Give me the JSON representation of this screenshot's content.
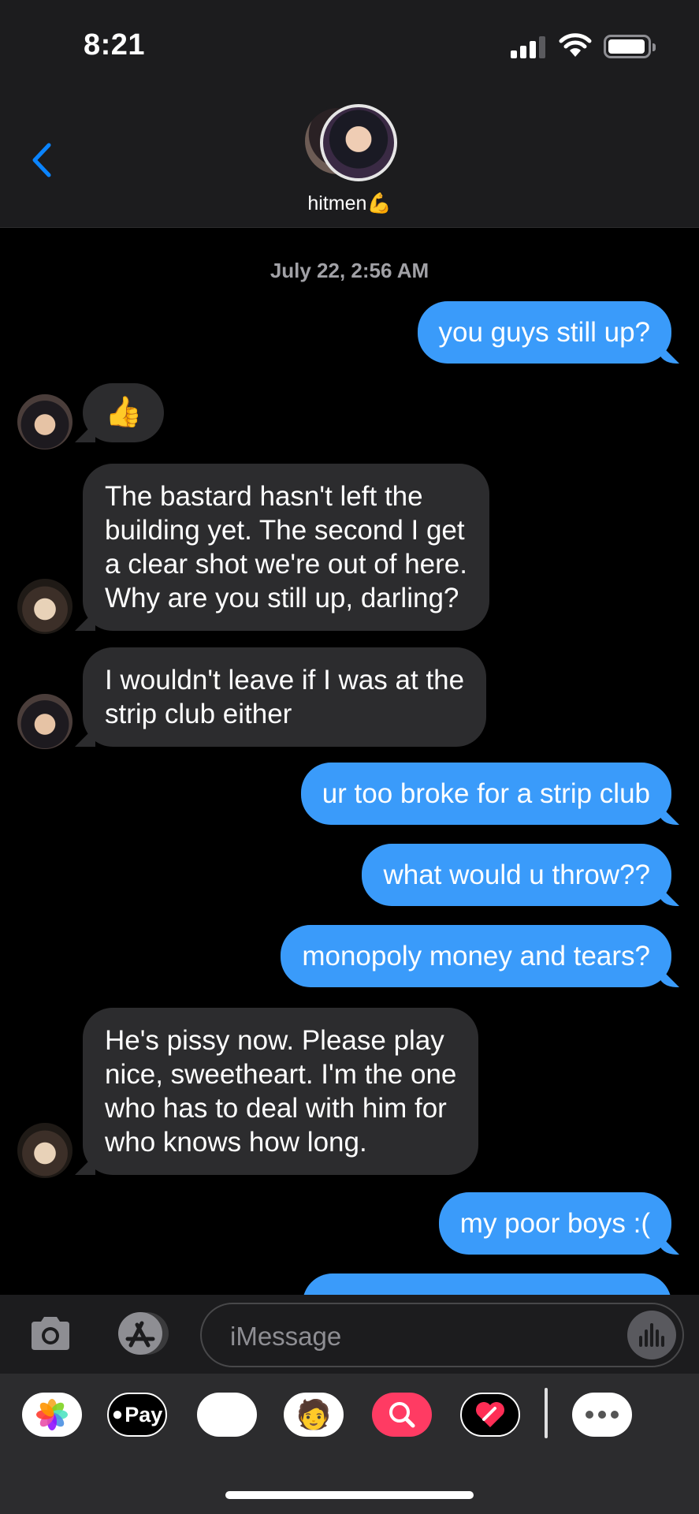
{
  "status_bar": {
    "time": "8:21"
  },
  "header": {
    "group_name": "hitmen💪"
  },
  "conversation": {
    "timestamp": "July 22, 2:56 AM",
    "messages": [
      {
        "direction": "out",
        "text": "you guys still up?"
      },
      {
        "direction": "in",
        "sender_icon": "avatar-toji",
        "text": "👍"
      },
      {
        "direction": "in",
        "sender_icon": "avatar-geto",
        "lines": [
          "The bastard hasn't left the",
          "building yet. The second I get",
          "a clear shot we're out of here.",
          "Why are you still up, darling?"
        ]
      },
      {
        "direction": "in",
        "sender_icon": "avatar-toji",
        "lines": [
          "I wouldn't leave if I was at the",
          "strip club either"
        ]
      },
      {
        "direction": "out",
        "text": "ur too broke for a strip club"
      },
      {
        "direction": "out",
        "text": "what would u throw??"
      },
      {
        "direction": "out",
        "text": "monopoly money and tears?"
      },
      {
        "direction": "in",
        "sender_icon": "avatar-geto",
        "lines": [
          "He's pissy now. Please play",
          "nice, sweetheart. I'm the one",
          "who has to deal with him for",
          "who knows how long."
        ]
      },
      {
        "direction": "out",
        "text": "my poor boys :("
      }
    ]
  },
  "input": {
    "placeholder": "iMessage"
  },
  "app_drawer": {
    "apple_pay_label": "Pay",
    "items": [
      "photos-icon",
      "apple-pay-icon",
      "animoji-icon",
      "memoji-icon",
      "images-search-icon",
      "digital-touch-icon",
      "more-icon"
    ]
  },
  "colors": {
    "outgoing_bubble": "#3a9bfa",
    "incoming_bubble": "#2c2c2e",
    "accent": "#0a84ff"
  }
}
